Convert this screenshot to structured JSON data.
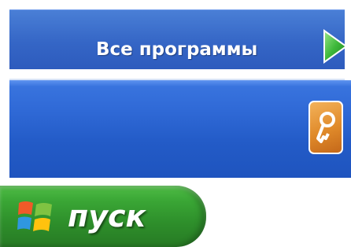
{
  "start_menu": {
    "all_programs_label": "Все программы",
    "arrow_icon": "green-right-arrow-icon",
    "logoff_icon": "key-icon",
    "colors": {
      "menu_blue": "#3566c6",
      "footer_blue": "#2f69d6",
      "logoff_orange": "#e08a2a",
      "arrow_green": "#3db83a"
    }
  },
  "taskbar": {
    "start_label": "пуск",
    "start_icon": "windows-logo-icon",
    "colors": {
      "start_green": "#3aa635"
    }
  }
}
